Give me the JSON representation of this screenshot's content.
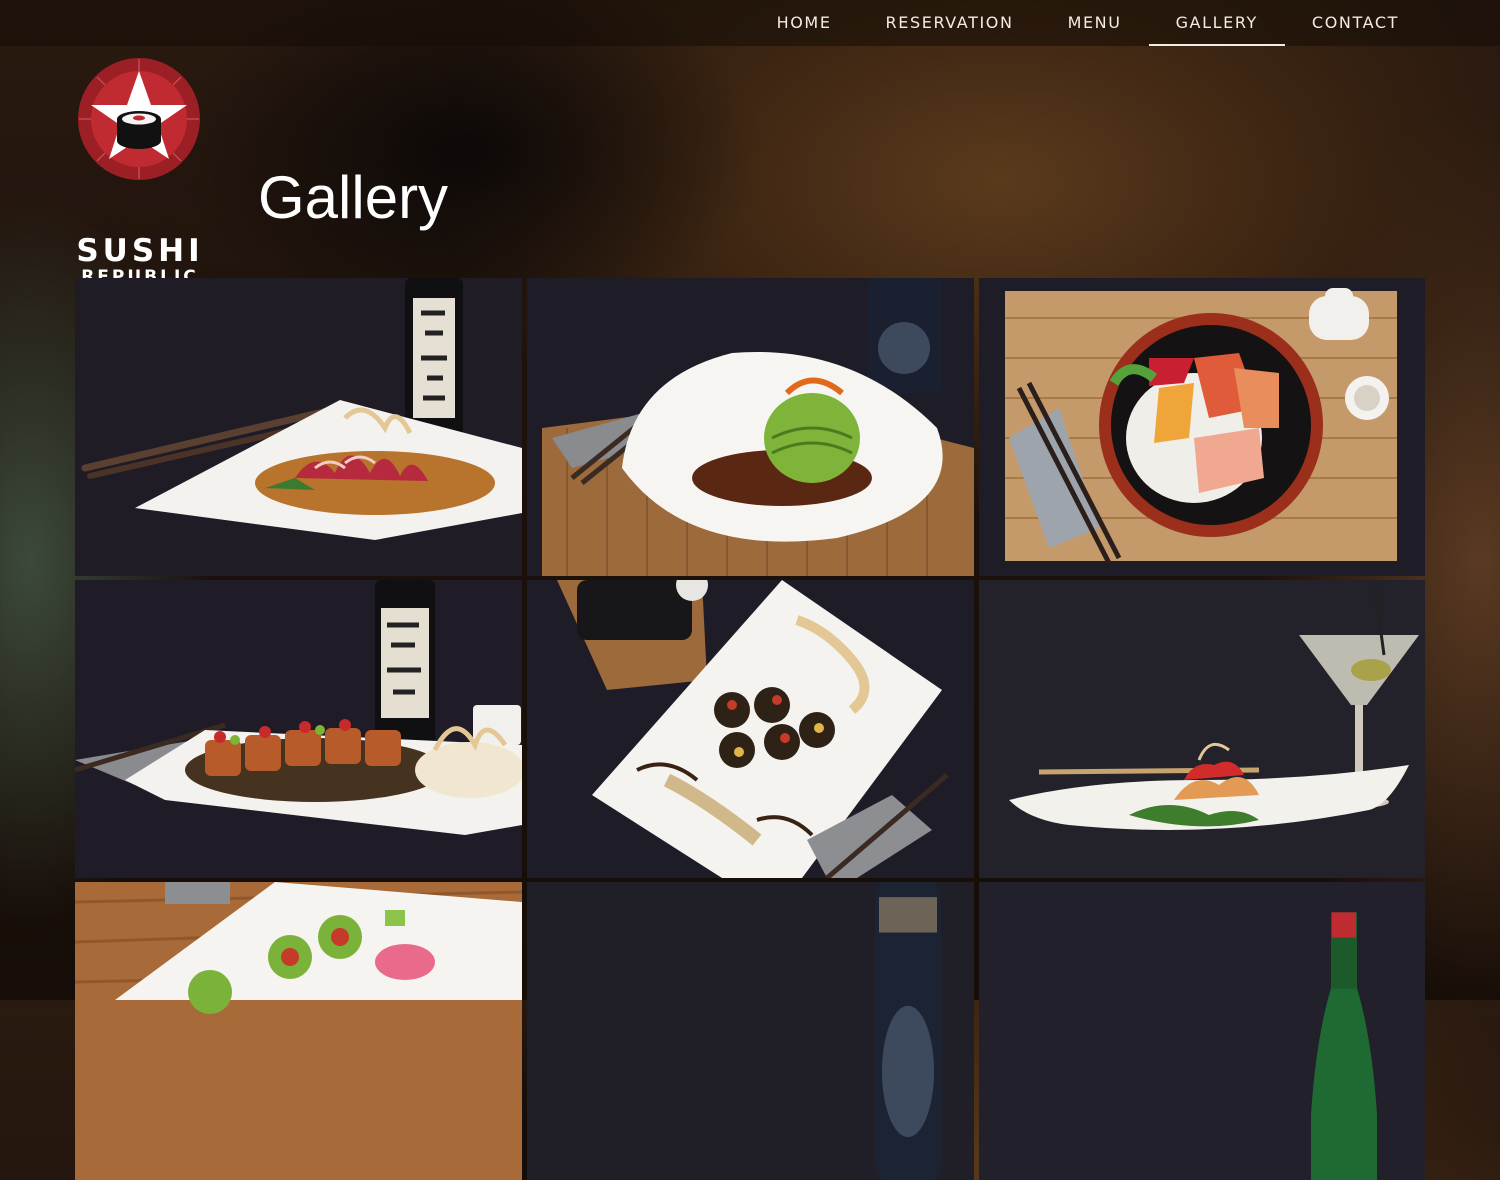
{
  "nav": {
    "items": [
      {
        "label": "HOME",
        "active": false
      },
      {
        "label": "RESERVATION",
        "active": false
      },
      {
        "label": "MENU",
        "active": false
      },
      {
        "label": "GALLERY",
        "active": true
      },
      {
        "label": "CONTACT",
        "active": false
      }
    ]
  },
  "brand": {
    "line1": "SUSHI",
    "line2": "REPUBLIC"
  },
  "page": {
    "title": "Gallery"
  },
  "colors": {
    "logo_red": "#b0232a",
    "nav_text": "#f2ece4",
    "tile_dark": "#1e1c25"
  },
  "gallery": [
    {
      "name": "tuna-tataki-plate"
    },
    {
      "name": "avocado-ball-bowl"
    },
    {
      "name": "chirashi-bowl"
    },
    {
      "name": "roll-platter"
    },
    {
      "name": "sushi-rolls-diagonal"
    },
    {
      "name": "martini-appetizer"
    },
    {
      "name": "kiwi-nigiri-plate"
    },
    {
      "name": "sake-bottle-partial"
    },
    {
      "name": "green-bottle-partial"
    }
  ]
}
